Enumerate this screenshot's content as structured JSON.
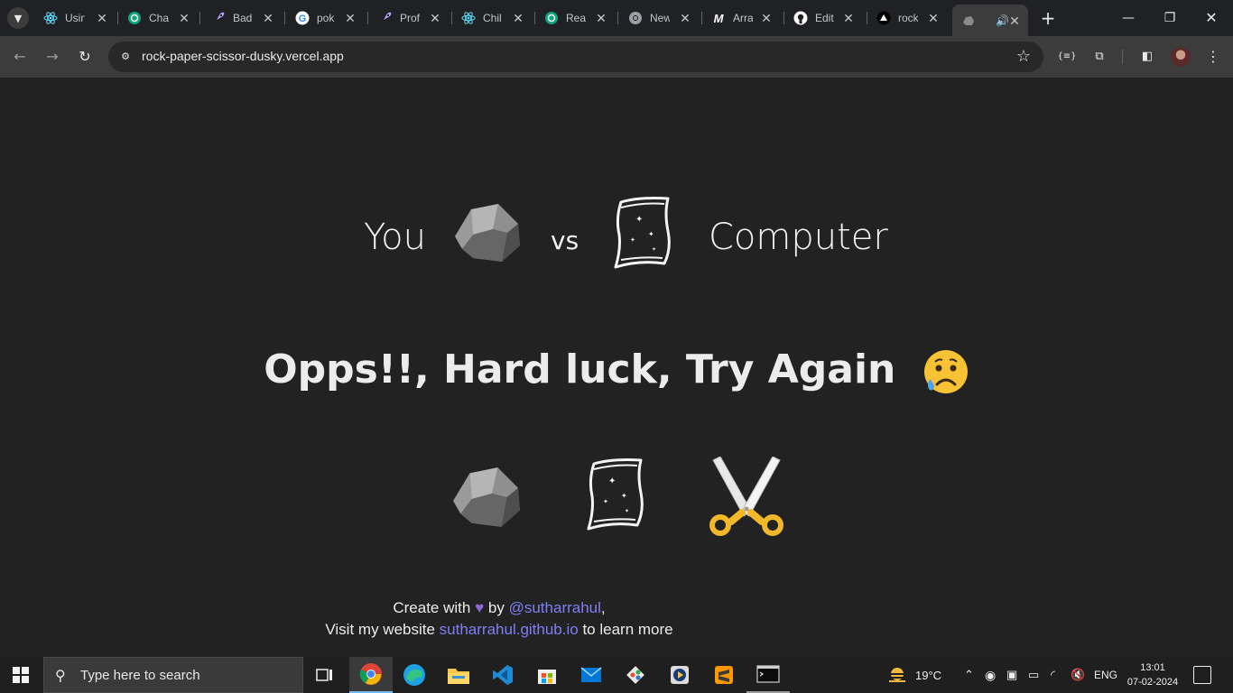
{
  "browser": {
    "tabs": [
      {
        "title": "Usin",
        "icon": "react-icon"
      },
      {
        "title": "Cha",
        "icon": "chatgpt-icon"
      },
      {
        "title": "Bad",
        "icon": "rocket-icon"
      },
      {
        "title": "pok",
        "icon": "google-icon"
      },
      {
        "title": "Prof",
        "icon": "rocket-icon"
      },
      {
        "title": "Chil",
        "icon": "react-icon"
      },
      {
        "title": "Rea",
        "icon": "chatgpt-icon"
      },
      {
        "title": "New",
        "icon": "chrome-icon"
      },
      {
        "title": "Arra",
        "icon": "m-icon"
      },
      {
        "title": "Edit",
        "icon": "github-icon"
      },
      {
        "title": "rock",
        "icon": "vercel-icon"
      },
      {
        "title": "",
        "icon": "rock-icon",
        "active": true
      }
    ],
    "url": "rock-paper-scissor-dusky.vercel.app"
  },
  "game": {
    "you_label": "You",
    "vs_label": "vs",
    "computer_label": "Computer",
    "player_choice": "rock",
    "computer_choice": "paper",
    "result_text": "Opps!!, Hard luck, Try Again",
    "options": [
      "rock",
      "paper",
      "scissors"
    ]
  },
  "footer": {
    "line1_prefix": "Create with",
    "line1_by": "by",
    "author_link": "@sutharrahul",
    "line1_suffix": ",",
    "line2_prefix": "Visit my website",
    "website_link": "sutharrahul.github.io",
    "line2_suffix": "to learn more"
  },
  "taskbar": {
    "search_placeholder": "Type here to search",
    "weather": "19°C",
    "language": "ENG",
    "time": "13:01",
    "date": "07-02-2024"
  },
  "colors": {
    "page_bg": "#222222",
    "link": "#7f7ff5",
    "heart": "#8c67d6"
  }
}
